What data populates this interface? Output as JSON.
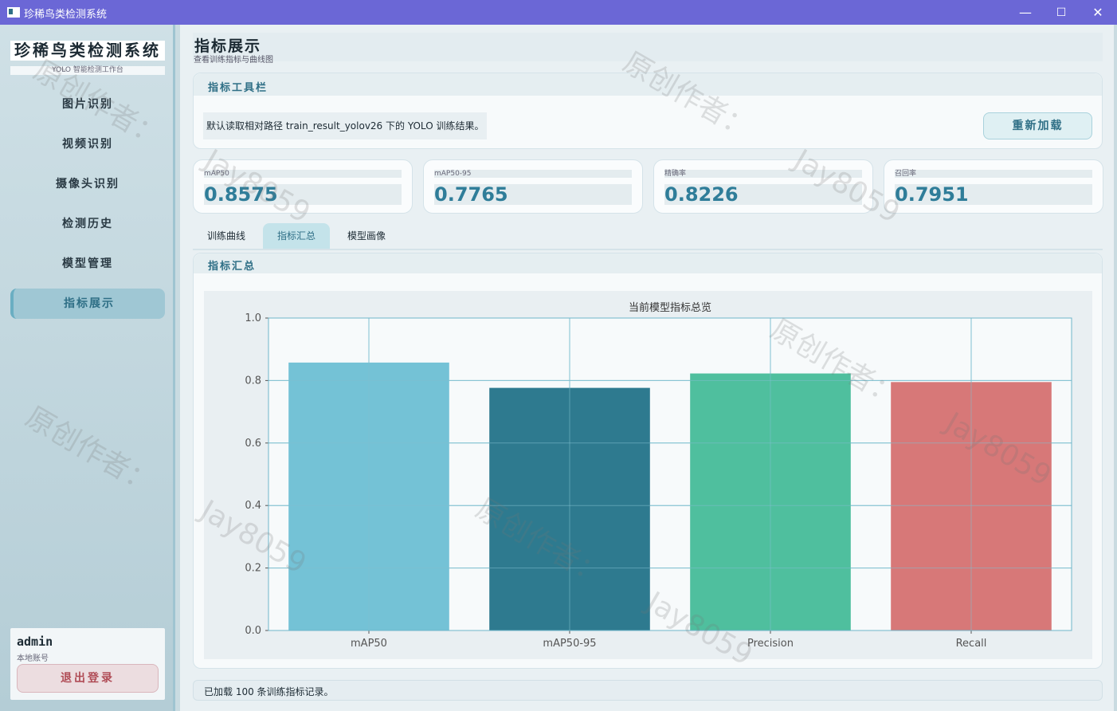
{
  "window": {
    "title": "珍稀鸟类检测系统",
    "minimize": "—",
    "maximize": "☐",
    "close": "✕"
  },
  "sidebar": {
    "brand": "珍稀鸟类检测系统",
    "brand_sub": "YOLO 智能检测工作台",
    "items": [
      {
        "label": "图片识别"
      },
      {
        "label": "视频识别"
      },
      {
        "label": "摄像头识别"
      },
      {
        "label": "检测历史"
      },
      {
        "label": "模型管理"
      },
      {
        "label": "指标展示",
        "active": true
      }
    ],
    "user": {
      "name": "admin",
      "sub": "本地账号",
      "logout": "退出登录"
    }
  },
  "header": {
    "title": "指标展示",
    "subtitle": "查看训练指标与曲线图"
  },
  "toolbar": {
    "title": "指标工具栏",
    "message": "默认读取相对路径 train_result_yolov26 下的 YOLO 训练结果。",
    "reload": "重新加载"
  },
  "metrics": [
    {
      "label": "mAP50",
      "value": "0.8575"
    },
    {
      "label": "mAP50-95",
      "value": "0.7765"
    },
    {
      "label": "精确率",
      "value": "0.8226"
    },
    {
      "label": "召回率",
      "value": "0.7951"
    }
  ],
  "tabs": [
    {
      "label": "训练曲线"
    },
    {
      "label": "指标汇总",
      "active": true
    },
    {
      "label": "模型画像"
    }
  ],
  "panel": {
    "title": "指标汇总"
  },
  "chart_data": {
    "type": "bar",
    "title": "当前模型指标总览",
    "categories": [
      "mAP50",
      "mAP50-95",
      "Precision",
      "Recall"
    ],
    "values": [
      0.8575,
      0.7765,
      0.8226,
      0.7951
    ],
    "colors": [
      "#74c2d6",
      "#2e7a8f",
      "#4fbf9e",
      "#d77878"
    ],
    "ylim": [
      0,
      1.0
    ],
    "yticks": [
      "0.0",
      "0.2",
      "0.4",
      "0.6",
      "0.8",
      "1.0"
    ],
    "grid": true
  },
  "status": "已加载 100 条训练指标记录。",
  "watermark": {
    "text1": "原创作者：",
    "text2": "Jay8059"
  }
}
